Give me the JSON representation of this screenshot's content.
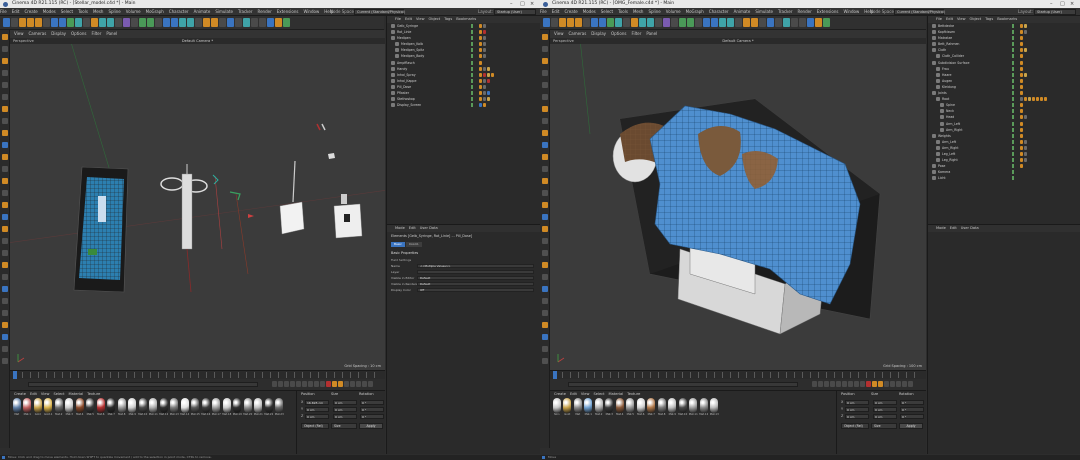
{
  "windowA": {
    "title": "Cinema 4D R21.115 (RC) - [Stellar_model.c4d *] - Main",
    "menus": [
      "File",
      "Edit",
      "Create",
      "Modes",
      "Select",
      "Tools",
      "Mesh",
      "Spline",
      "Volume",
      "MoGraph",
      "Character",
      "Animate",
      "Simulate",
      "Tracker",
      "Render",
      "Extensions",
      "Window",
      "Help"
    ],
    "node_space_label": "Node Space:",
    "node_space_value": "Current (Standard/Physical)",
    "layout_label": "Layout:",
    "layout_value": "Startup (User)",
    "viewport_menus": [
      "View",
      "Cameras",
      "Display",
      "Options",
      "Filter",
      "Panel"
    ],
    "viewport_name": "Perspective",
    "camera_label": "Default Camera *",
    "grid_spacing": "Grid Spacing : 10 cm",
    "object_menus": [
      "File",
      "Edit",
      "View",
      "Object",
      "Tags",
      "Bookmarks"
    ],
    "objects": [
      {
        "name": "Gelb_Syringe",
        "indent": 0,
        "tags": [
          "#d08a25",
          "#6a6a6a"
        ]
      },
      {
        "name": "Rot_Linie",
        "indent": 0,
        "tags": [
          "#d08a25",
          "#b33030"
        ]
      },
      {
        "name": "Medipen",
        "indent": 0,
        "tags": [
          "#d08a25",
          "#6a6a6a"
        ]
      },
      {
        "name": "Medipen_Kolb",
        "indent": 1,
        "tags": [
          "#d08a25",
          "#6a6a6a"
        ]
      },
      {
        "name": "Medipen_Spitz",
        "indent": 1,
        "tags": [
          "#d08a25",
          "#6a6a6a"
        ]
      },
      {
        "name": "Medipen_Body",
        "indent": 1,
        "tags": [
          "#d08a25",
          "#6a6a6a"
        ]
      },
      {
        "name": "Ampfflasch",
        "indent": 0,
        "tags": [
          "#d08a25"
        ]
      },
      {
        "name": "Handy",
        "indent": 0,
        "tags": [
          "#d08a25",
          "#6a6a6a",
          "#c9a34a"
        ]
      },
      {
        "name": "Inhal_Spray",
        "indent": 0,
        "tags": [
          "#d08a25",
          "#b33030",
          "#c9a34a",
          "#d08a25"
        ]
      },
      {
        "name": "Inhal_Kappe",
        "indent": 0,
        "tags": [
          "#d08a25",
          "#6a6a6a",
          "#b33030"
        ]
      },
      {
        "name": "Pill_Dose",
        "indent": 0,
        "tags": [
          "#d08a25",
          "#6a6a6a"
        ]
      },
      {
        "name": "Pflaster",
        "indent": 0,
        "tags": [
          "#d08a25",
          "#6a6a6a",
          "#3a74c0"
        ]
      },
      {
        "name": "Stethoskop",
        "indent": 0,
        "tags": [
          "#d08a25",
          "#6a6a6a",
          "#c9a34a"
        ]
      },
      {
        "name": "Display_Screen",
        "indent": 0,
        "tags": [
          "#3a74c0",
          "#d08a25"
        ]
      }
    ],
    "attr_menus": [
      "Mode",
      "Edit",
      "User Data"
    ],
    "attr_desc": "Elements [Gelb_Syringe, Rot_Linie] ... Pill_Dose]",
    "attr_tabs": [
      "Basic",
      "Coord."
    ],
    "attr_section": "Basic Properties",
    "attr_sub": "Field Settings",
    "attr_rows": [
      {
        "label": "Name",
        "value": "<<Multiple Values>>"
      },
      {
        "label": "Layer",
        "value": ""
      },
      {
        "label": "Visible in Editor",
        "value": "Default"
      },
      {
        "label": "Visible in Renderer",
        "value": "Default"
      },
      {
        "label": "Display Color",
        "value": "Off"
      }
    ],
    "mat_menus": [
      "Create",
      "Edit",
      "View",
      "Select",
      "Material",
      "Texture"
    ],
    "materials": [
      {
        "name": "Mat",
        "color": "#5e7fa8"
      },
      {
        "name": "Mat.1",
        "color": "#c06060"
      },
      {
        "name": "Gold",
        "color": "#c9a34a"
      },
      {
        "name": "Gold.1",
        "color": "#d9b24a"
      },
      {
        "name": "Mat.2",
        "color": "#6a6a6a"
      },
      {
        "name": "Mat.3",
        "color": "#c9c9c9"
      },
      {
        "name": "Mat.4",
        "color": "#8a4a2a"
      },
      {
        "name": "Mat.5",
        "color": "#3a3a3a"
      },
      {
        "name": "Mat.6",
        "color": "#b33030"
      },
      {
        "name": "Mat.7",
        "color": "#2a2a2a"
      },
      {
        "name": "Mat.8",
        "color": "#9a9a9a"
      },
      {
        "name": "Mat.9",
        "color": "#d0d0d0"
      },
      {
        "name": "Mat.10",
        "color": "#4a4a4a"
      },
      {
        "name": "Mat.11",
        "color": "#b0b0b0"
      },
      {
        "name": "Mat.12",
        "color": "#2f2f2f"
      },
      {
        "name": "Mat.13",
        "color": "#7a7a7a"
      },
      {
        "name": "Mat.14",
        "color": "#e0e0e0"
      },
      {
        "name": "Mat.15",
        "color": "#585858"
      },
      {
        "name": "Mat.16",
        "color": "#3c3c3c"
      },
      {
        "name": "Mat.17",
        "color": "#a0a0a0"
      },
      {
        "name": "Mat.18",
        "color": "#cccccc"
      },
      {
        "name": "Mat.19",
        "color": "#2e2e2e"
      },
      {
        "name": "Mat.20",
        "color": "#909090"
      },
      {
        "name": "Mat.21",
        "color": "#bdbdbd"
      },
      {
        "name": "Mat.22",
        "color": "#333333"
      },
      {
        "name": "Mat.23",
        "color": "#6c6c6c"
      }
    ],
    "coord_headers": [
      "Position",
      "Size",
      "Rotation"
    ],
    "coord_rows": [
      {
        "axis": "X",
        "pos": "16.695 cm",
        "size": "0 cm",
        "rot": "0 °"
      },
      {
        "axis": "Y",
        "pos": "0 cm",
        "size": "0 cm",
        "rot": "0 °"
      },
      {
        "axis": "Z",
        "pos": "0 cm",
        "size": "0 cm",
        "rot": "0 °"
      }
    ],
    "coord_mode": "Object (Rel)",
    "coord_size_mode": "Size",
    "apply_label": "Apply",
    "status": "Move: Click and drag to move elements. Hold down SHIFT to quantize movement / add to the selection in point mode, CTRL to remove."
  },
  "windowB": {
    "title": "Cinema 4D R21.115 (RC) - [OMG_Female.c4d *] - Main",
    "menus": [
      "File",
      "Edit",
      "Create",
      "Modes",
      "Select",
      "Tools",
      "Mesh",
      "Spline",
      "Volume",
      "MoGraph",
      "Character",
      "Animate",
      "Simulate",
      "Tracker",
      "Render",
      "Extensions",
      "Window",
      "Help"
    ],
    "node_space_label": "Node Space:",
    "node_space_value": "Current (Standard/Physical)",
    "layout_label": "Layout:",
    "layout_value": "Startup (User)",
    "viewport_menus": [
      "View",
      "Cameras",
      "Display",
      "Options",
      "Filter",
      "Panel"
    ],
    "viewport_name": "Perspective",
    "camera_label": "Default Camera *",
    "grid_spacing": "Grid Spacing : 100 cm",
    "object_menus": [
      "File",
      "Edit",
      "View",
      "Object",
      "Tags",
      "Bookmarks"
    ],
    "objects": [
      {
        "name": "Bettdecke",
        "indent": 0,
        "tags": [
          "#d08a25",
          "#c9a34a"
        ]
      },
      {
        "name": "Kopfkissen",
        "indent": 0,
        "tags": [
          "#d08a25",
          "#6a6a6a"
        ]
      },
      {
        "name": "Matratze",
        "indent": 0,
        "tags": [
          "#d08a25"
        ]
      },
      {
        "name": "Bett_Rahmen",
        "indent": 0,
        "tags": [
          "#d08a25"
        ]
      },
      {
        "name": "Cloth",
        "indent": 0,
        "tags": [
          "#d08a25",
          "#c9a34a"
        ]
      },
      {
        "name": "Cloth_Collider",
        "indent": 1,
        "tags": [
          "#d08a25"
        ]
      },
      {
        "name": "Subdivision Surface",
        "indent": 0,
        "tags": [
          "#d08a25"
        ]
      },
      {
        "name": "Frau",
        "indent": 1,
        "tags": [
          "#d08a25"
        ]
      },
      {
        "name": "Haare",
        "indent": 1,
        "tags": [
          "#d08a25",
          "#c9a34a"
        ]
      },
      {
        "name": "Augen",
        "indent": 1,
        "tags": [
          "#d08a25"
        ]
      },
      {
        "name": "Kleidung",
        "indent": 1,
        "tags": [
          "#d08a25"
        ]
      },
      {
        "name": "Joints",
        "indent": 0,
        "tags": [
          "#d08a25"
        ]
      },
      {
        "name": "Root",
        "indent": 1,
        "tags": [
          "#6a6a6a",
          "#d08a25",
          "#c9a34a",
          "#d08a25",
          "#d08a25",
          "#d08a25",
          "#d08a25"
        ]
      },
      {
        "name": "Spine",
        "indent": 2,
        "tags": [
          "#d08a25"
        ]
      },
      {
        "name": "Neck",
        "indent": 2,
        "tags": [
          "#d08a25"
        ]
      },
      {
        "name": "Head",
        "indent": 2,
        "tags": [
          "#d08a25",
          "#6a6a6a"
        ]
      },
      {
        "name": "Arm_Left",
        "indent": 2,
        "tags": [
          "#d08a25"
        ]
      },
      {
        "name": "Arm_Right",
        "indent": 2,
        "tags": [
          "#d08a25"
        ]
      },
      {
        "name": "Weights",
        "indent": 0,
        "tags": [
          "#d08a25"
        ]
      },
      {
        "name": "Arm_Left",
        "indent": 1,
        "tags": [
          "#d08a25",
          "#6a6a6a"
        ]
      },
      {
        "name": "Arm_Right",
        "indent": 1,
        "tags": [
          "#d08a25",
          "#6a6a6a"
        ]
      },
      {
        "name": "Leg_Left",
        "indent": 1,
        "tags": [
          "#d08a25",
          "#6a6a6a"
        ]
      },
      {
        "name": "Leg_Right",
        "indent": 1,
        "tags": [
          "#d08a25",
          "#6a6a6a"
        ]
      },
      {
        "name": "Pose",
        "indent": 0,
        "tags": [
          "#d08a25"
        ]
      },
      {
        "name": "Kamera",
        "indent": 0,
        "tags": []
      },
      {
        "name": "Licht",
        "indent": 0,
        "tags": []
      }
    ],
    "attr_menus": [
      "Mode",
      "Edit",
      "User Data"
    ],
    "mat_menus": [
      "Create",
      "Edit",
      "View",
      "Select",
      "Material",
      "Texture"
    ],
    "materials": [
      {
        "name": "Skin",
        "color": "#c9c9c9"
      },
      {
        "name": "Gold",
        "color": "#c9a34a"
      },
      {
        "name": "Mat",
        "color": "#8a8a8a"
      },
      {
        "name": "Mat.1",
        "color": "#6fa0d0"
      },
      {
        "name": "Mat.2",
        "color": "#b0b0b0"
      },
      {
        "name": "Mat.3",
        "color": "#3a3a3a"
      },
      {
        "name": "Mat.4",
        "color": "#8a5a3a"
      },
      {
        "name": "Mat.5",
        "color": "#9a9a9a"
      },
      {
        "name": "Mat.6",
        "color": "#d0d0d0"
      },
      {
        "name": "Mat.7",
        "color": "#b0784a"
      },
      {
        "name": "Mat.8",
        "color": "#7a7a7a"
      },
      {
        "name": "Mat.9",
        "color": "#c0c0c0"
      },
      {
        "name": "Mat.10",
        "color": "#4a4a4a"
      },
      {
        "name": "Mat.11",
        "color": "#a0a0a0"
      },
      {
        "name": "Mat.12",
        "color": "#8a8a8a"
      },
      {
        "name": "Mat.13",
        "color": "#bcbcbc"
      }
    ],
    "coord_rows": [
      {
        "axis": "X",
        "pos": "0 cm",
        "size": "0 cm",
        "rot": "0 °"
      },
      {
        "axis": "Y",
        "pos": "0 cm",
        "size": "0 cm",
        "rot": "0 °"
      },
      {
        "axis": "Z",
        "pos": "0 cm",
        "size": "0 cm",
        "rot": "0 °"
      }
    ],
    "coord_mode": "Object (Rel)",
    "coord_size_mode": "Size",
    "apply_label": "Apply",
    "status": "Move"
  }
}
